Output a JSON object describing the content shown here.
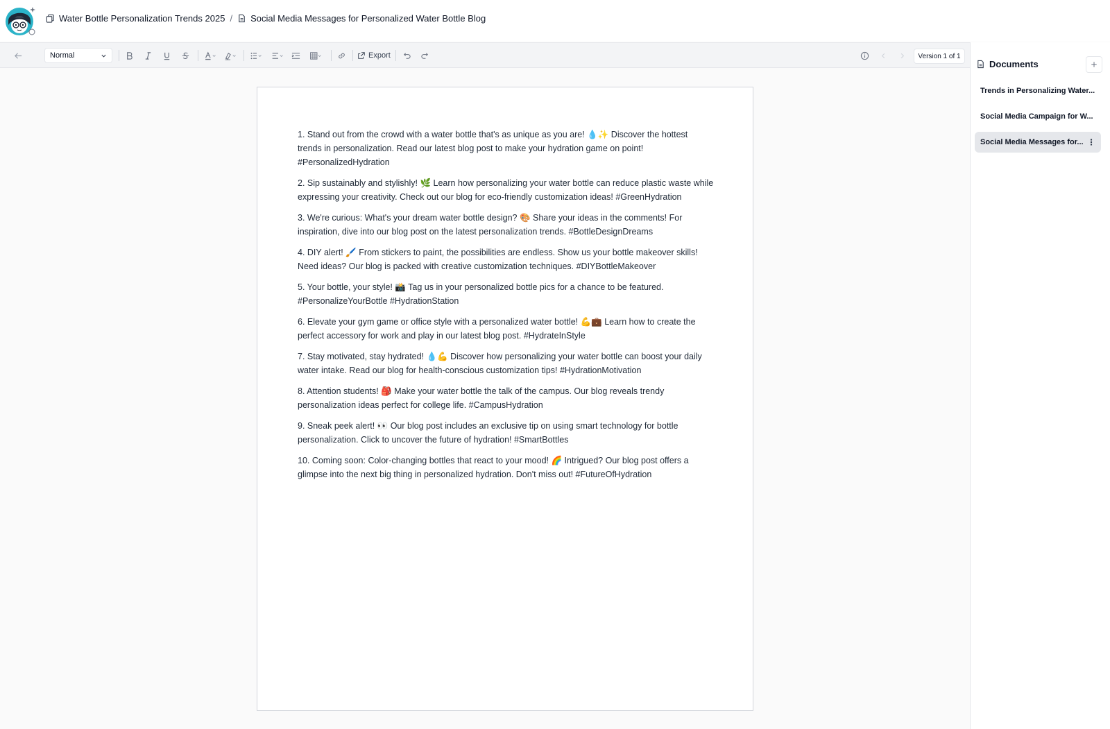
{
  "header": {
    "project_title": "Water Bottle Personalization Trends 2025",
    "separator": "/",
    "document_title": "Social Media Messages for Personalized Water Bottle Blog"
  },
  "toolbar": {
    "style_select": "Normal",
    "export_label": "Export",
    "version_label": "Version 1 of 1"
  },
  "document": {
    "paragraphs": [
      "1. Stand out from the crowd with a water bottle that's as unique as you are! 💧✨ Discover the hottest trends in personalization. Read our latest blog post to make your hydration game on point! #PersonalizedHydration",
      "2. Sip sustainably and stylishly! 🌿 Learn how personalizing your water bottle can reduce plastic waste while expressing your creativity. Check out our blog for eco-friendly customization ideas! #GreenHydration",
      "3. We're curious: What's your dream water bottle design? 🎨 Share your ideas in the comments! For inspiration, dive into our blog post on the latest personalization trends. #BottleDesignDreams",
      "4. DIY alert! 🖌️ From stickers to paint, the possibilities are endless. Show us your bottle makeover skills! Need ideas? Our blog is packed with creative customization techniques. #DIYBottleMakeover",
      "5. Your bottle, your style! 📸 Tag us in your personalized bottle pics for a chance to be featured. #PersonalizeYourBottle #HydrationStation",
      "6. Elevate your gym game or office style with a personalized water bottle! 💪💼 Learn how to create the perfect accessory for work and play in our latest blog post. #HydrateInStyle",
      "7. Stay motivated, stay hydrated! 💧💪 Discover how personalizing your water bottle can boost your daily water intake. Read our blog for health-conscious customization tips! #HydrationMotivation",
      "8. Attention students! 🎒 Make your water bottle the talk of the campus. Our blog reveals trendy personalization ideas perfect for college life. #CampusHydration",
      "9. Sneak peek alert! 👀 Our blog post includes an exclusive tip on using smart technology for bottle personalization. Click to uncover the future of hydration! #SmartBottles",
      "10. Coming soon: Color-changing bottles that react to your mood! 🌈 Intrigued? Our blog post offers a glimpse into the next big thing in personalized hydration. Don't miss out! #FutureOfHydration"
    ]
  },
  "sidebar": {
    "title": "Documents",
    "items": [
      {
        "label": "Trends in Personalizing Water..."
      },
      {
        "label": "Social Media Campaign for W..."
      },
      {
        "label": "Social Media Messages for..."
      }
    ]
  },
  "colors": {
    "accent_avatar": "#2bb3c8",
    "active_item_bg": "#e5e7eb",
    "toolbar_bg": "#f3f4f6"
  },
  "icons": [
    "avatar-illustration",
    "copy-icon",
    "file-icon",
    "back-arrow-icon",
    "bold-icon",
    "italic-icon",
    "underline-icon",
    "strikethrough-icon",
    "text-color-icon",
    "highlight-icon",
    "list-icon",
    "align-icon",
    "indent-icon",
    "table-icon",
    "link-icon",
    "export-icon",
    "undo-icon",
    "redo-icon",
    "info-icon",
    "chevron-left-icon",
    "chevron-right-icon",
    "plus-icon",
    "kebab-icon"
  ]
}
